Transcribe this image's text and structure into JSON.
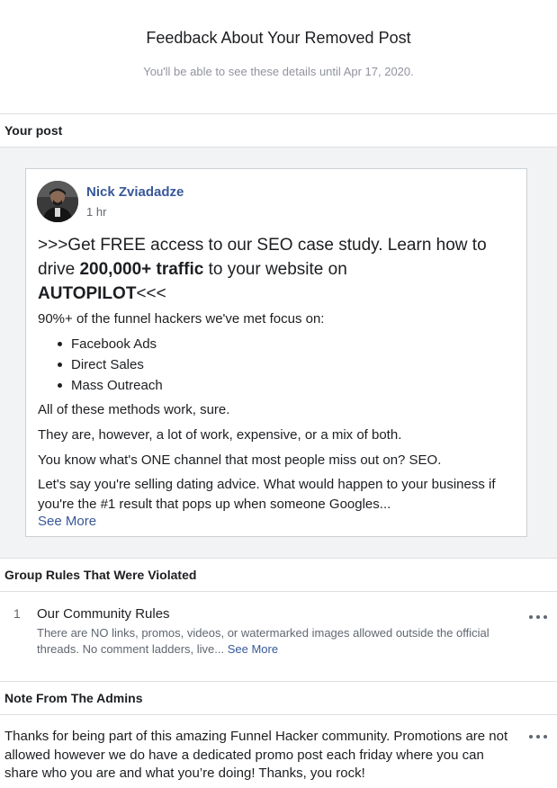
{
  "header": {
    "title": "Feedback About Your Removed Post",
    "subtitle": "You'll be able to see these details until Apr 17, 2020."
  },
  "sections": {
    "your_post": "Your post",
    "rules_violated": "Group Rules That Were Violated",
    "admin_note": "Note From The Admins"
  },
  "post": {
    "author": "Nick Zviadadze",
    "time": "1 hr",
    "headline_pre": ">>>Get FREE access to our SEO case study. Learn how to drive ",
    "headline_bold1": "200,000+ traffic",
    "headline_mid": " to your website on ",
    "headline_bold2": "AUTOPILOT",
    "headline_post": "<<<",
    "intro": "90%+ of the funnel hackers we've met focus on:",
    "bullets": [
      "Facebook Ads",
      "Direct Sales",
      "Mass Outreach"
    ],
    "para1": "All of these methods work, sure.",
    "para2": "They are, however, a lot of work, expensive, or a mix of both.",
    "para3": "You know what's ONE channel that most people miss out on? SEO.",
    "para4": "Let's say you're selling dating advice. What would happen to your business if you're the #1 result that pops up when someone Googles...",
    "see_more": "See More"
  },
  "rule": {
    "number": "1",
    "title": "Our Community Rules",
    "description": "There are NO links, promos, videos, or watermarked images allowed outside the official threads. No comment ladders, live...",
    "see_more": "See More"
  },
  "note": {
    "text": "Thanks for being part of this amazing Funnel Hacker community. Promotions are not allowed however we do have a dedicated promo post each friday where you can share who you are and what you’re doing! Thanks, you rock!"
  },
  "icons": {
    "more": "more-options-icon",
    "avatar": "profile-photo"
  }
}
